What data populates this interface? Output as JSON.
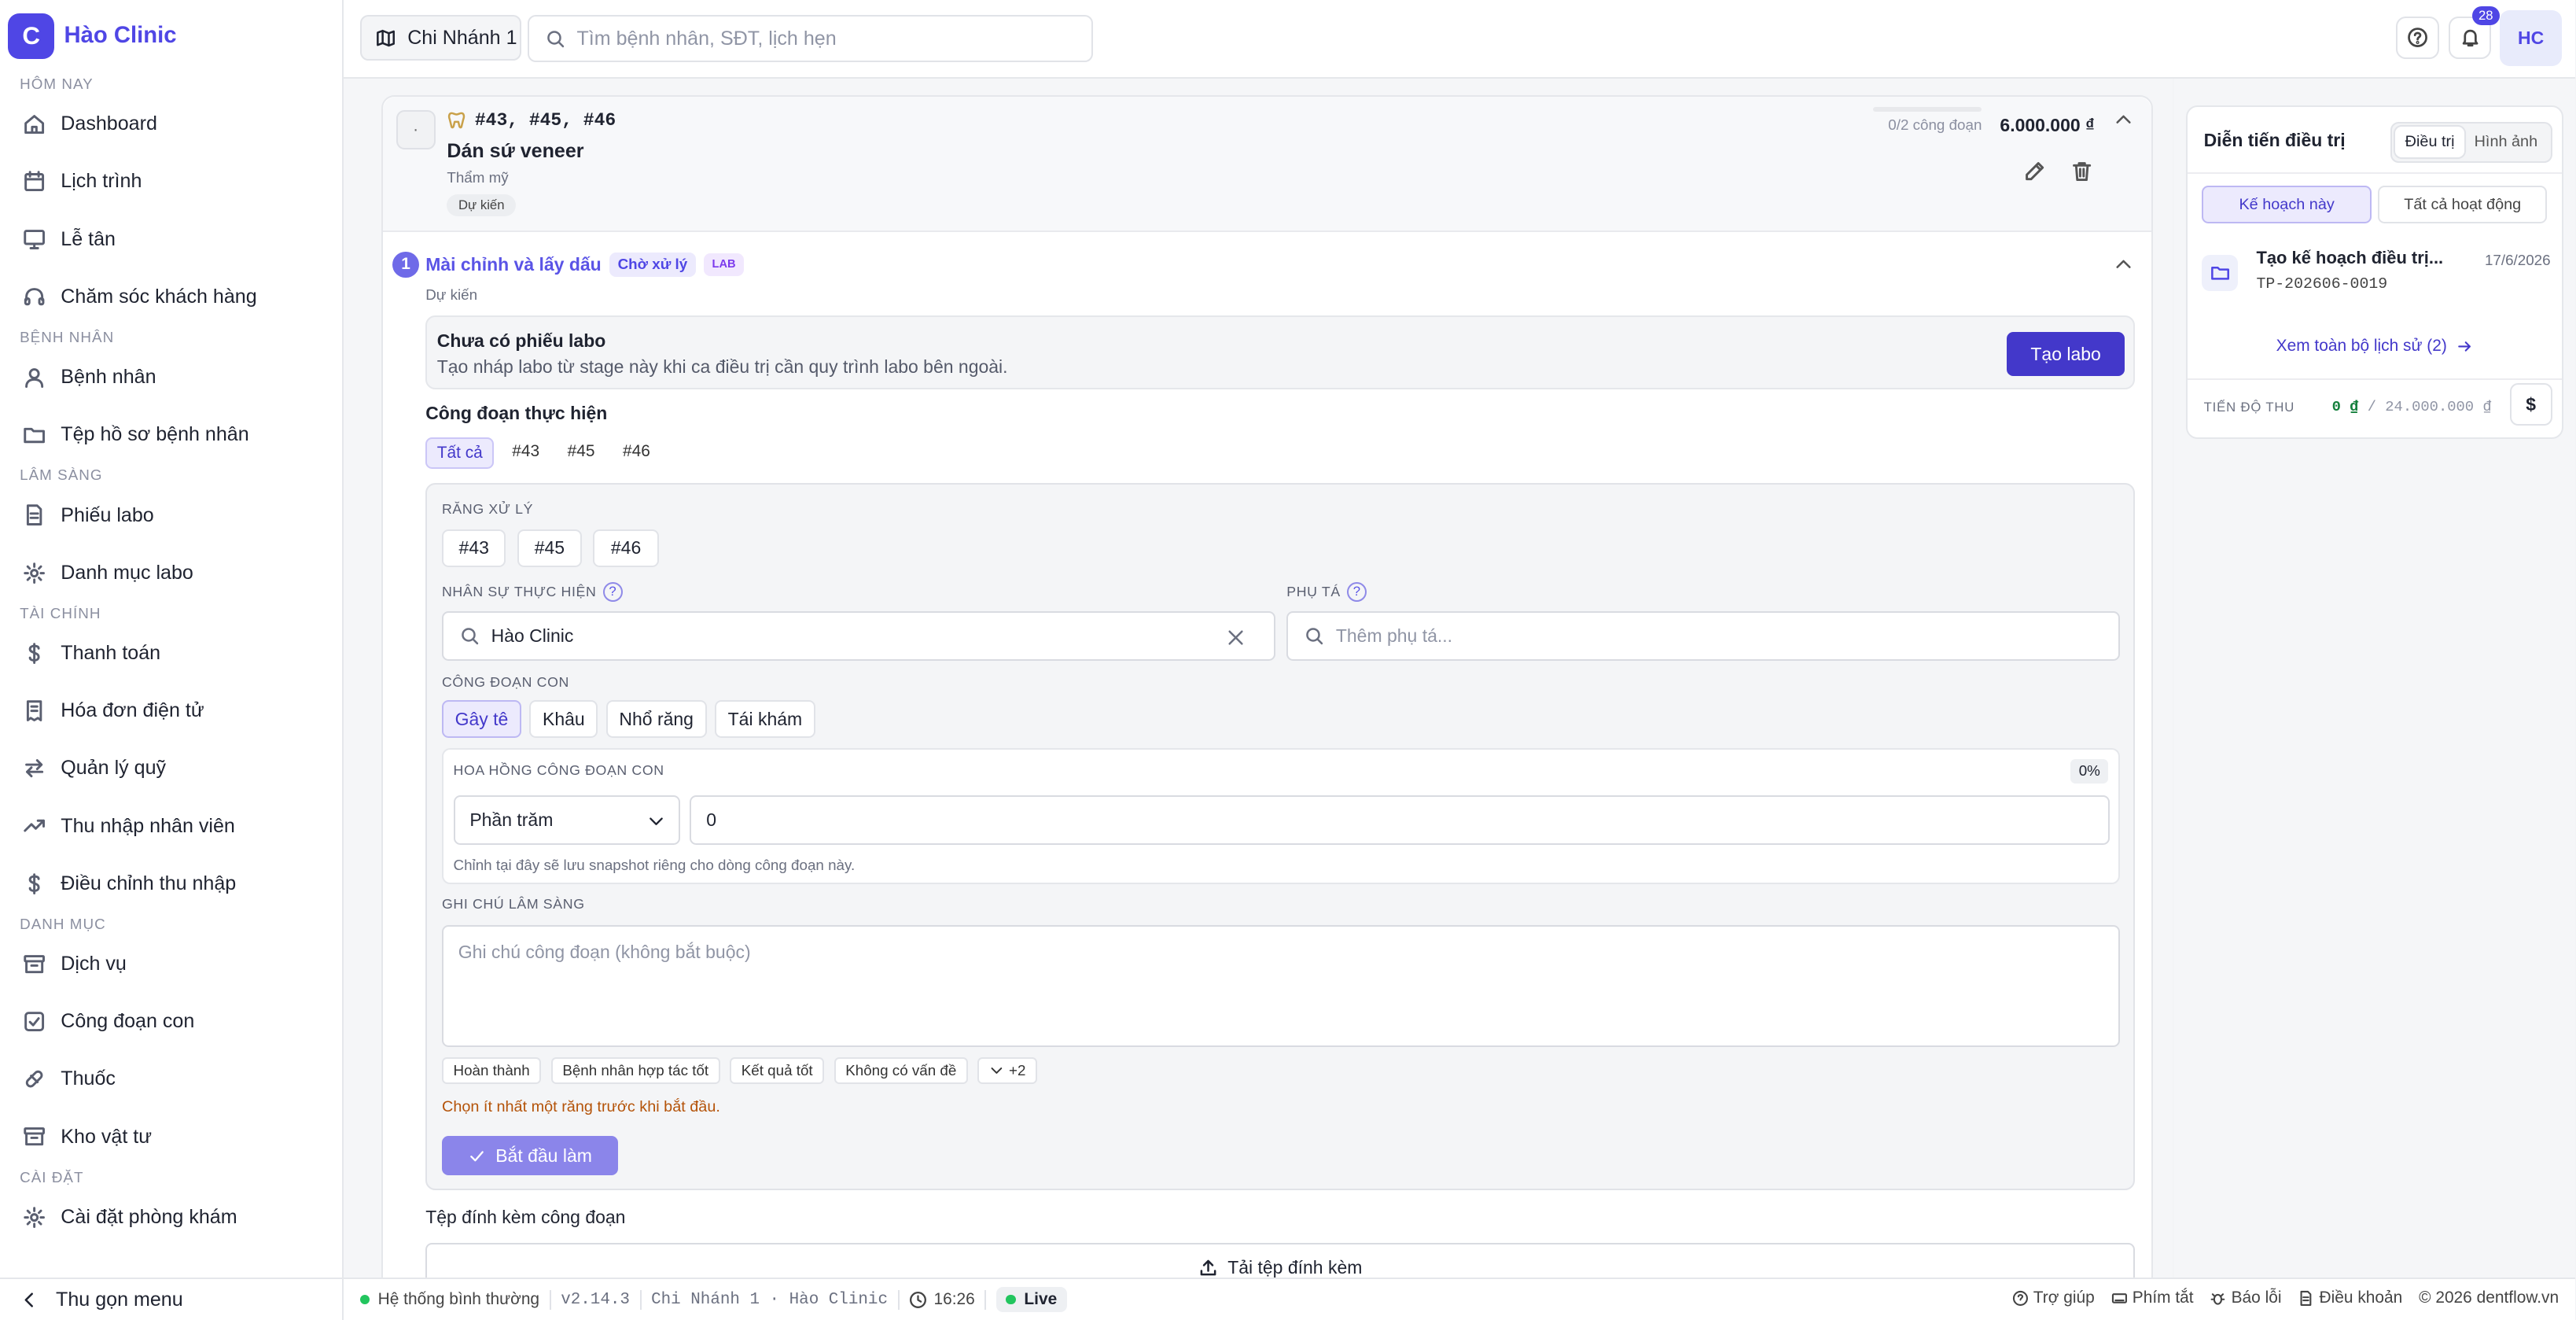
{
  "brand": {
    "logo_letter": "C",
    "name": "Hào Clinic"
  },
  "nav": {
    "groups": [
      {
        "label": "HÔM NAY",
        "items": [
          {
            "label": "Dashboard",
            "icon": "home-icon"
          },
          {
            "label": "Lịch trình",
            "icon": "calendar-icon"
          },
          {
            "label": "Lễ tân",
            "icon": "monitor-icon"
          },
          {
            "label": "Chăm sóc khách hàng",
            "icon": "headset-icon"
          }
        ]
      },
      {
        "label": "BỆNH NHÂN",
        "items": [
          {
            "label": "Bệnh nhân",
            "icon": "user-icon"
          },
          {
            "label": "Tệp hồ sơ bệnh nhân",
            "icon": "folder-icon"
          }
        ]
      },
      {
        "label": "LÂM SÀNG",
        "items": [
          {
            "label": "Phiếu labo",
            "icon": "file-icon"
          },
          {
            "label": "Danh mục labo",
            "icon": "gear-icon"
          }
        ]
      },
      {
        "label": "TÀI CHÍNH",
        "items": [
          {
            "label": "Thanh toán",
            "icon": "dollar-icon"
          },
          {
            "label": "Hóa đơn điện tử",
            "icon": "receipt-icon"
          },
          {
            "label": "Quản lý quỹ",
            "icon": "transfer-icon"
          },
          {
            "label": "Thu nhập nhân viên",
            "icon": "trend-icon"
          },
          {
            "label": "Điều chỉnh thu nhập",
            "icon": "dollar-icon"
          }
        ]
      },
      {
        "label": "DANH MỤC",
        "items": [
          {
            "label": "Dịch vụ",
            "icon": "archive-icon"
          },
          {
            "label": "Công đoạn con",
            "icon": "check-square-icon"
          },
          {
            "label": "Thuốc",
            "icon": "pill-icon"
          },
          {
            "label": "Kho vật tư",
            "icon": "archive-icon"
          }
        ]
      },
      {
        "label": "CÀI ĐẶT",
        "items": [
          {
            "label": "Cài đặt phòng khám",
            "icon": "gear-icon"
          }
        ]
      }
    ],
    "collapse_label": "Thu gọn menu"
  },
  "topbar": {
    "branch": "Chi Nhánh 1",
    "search_placeholder": "Tìm bệnh nhân, SĐT, lịch hẹn",
    "notif_count": "28",
    "avatar": "HC"
  },
  "plan_item": {
    "dot": "·",
    "teeth": "#43, #45, #46",
    "title": "Dán sứ veneer",
    "category": "Thẩm mỹ",
    "status": "Dự kiến",
    "progress_text": "0/2 công đoạn",
    "progress_fraction": 0,
    "price": "6.000.000 ₫"
  },
  "stage": {
    "number": "1",
    "name": "Mài chỉnh và lấy dấu",
    "badge_status": "Chờ xử lý",
    "badge_lab": "LAB",
    "status": "Dự kiến",
    "lab": {
      "title": "Chưa có phiếu labo",
      "desc": "Tạo nháp labo từ stage này khi ca điều trị cần quy trình labo bên ngoài.",
      "button": "Tạo labo"
    },
    "section_title": "Công đoạn thực hiện",
    "filters": [
      "Tất cả",
      "#43",
      "#45",
      "#46"
    ],
    "form": {
      "teeth_label": "RĂNG XỬ LÝ",
      "teeth": [
        "#43",
        "#45",
        "#46"
      ],
      "staff_label": "NHÂN SỰ THỰC HIỆN",
      "staff_value": "Hào Clinic",
      "assistant_label": "PHỤ TÁ",
      "assistant_placeholder": "Thêm phụ tá...",
      "substage_label": "CÔNG ĐOẠN CON",
      "substages": [
        "Gây tê",
        "Khâu",
        "Nhổ răng",
        "Tái khám"
      ],
      "commission_label": "HOA HỒNG CÔNG ĐOẠN CON",
      "commission_pct": "0%",
      "commission_type": "Phần trăm",
      "commission_value": "0",
      "commission_help": "Chỉnh tại đây sẽ lưu snapshot riêng cho dòng công đoạn này.",
      "note_label": "GHI CHÚ LÂM SÀNG",
      "note_placeholder": "Ghi chú công đoạn (không bắt buộc)",
      "quick_notes": [
        "Hoàn thành",
        "Bệnh nhân hợp tác tốt",
        "Kết quả tốt",
        "Không có vấn đề"
      ],
      "more_notes": "+2",
      "warning": "Chọn ít nhất một răng trước khi bắt đầu.",
      "start_button": "Bắt đầu làm"
    },
    "attach_title": "Tệp đính kèm công đoạn",
    "upload_button": "Tải tệp đính kèm"
  },
  "right": {
    "title": "Diễn tiến điều trị",
    "seg": [
      "Điều trị",
      "Hình ảnh"
    ],
    "scope_tabs": [
      "Kế hoạch này",
      "Tất cả hoạt động"
    ],
    "plan_name": "Tạo kế hoạch điều trị...",
    "plan_code": "TP-202606-0019",
    "plan_date": "17/6/2026",
    "history_link": "Xem toàn bộ lịch sử (2)",
    "pay_label": "TIẾN ĐỘ THU",
    "paid": "0 ₫",
    "total": "/ 24.000.000 ₫",
    "pay_button": "$"
  },
  "footer": {
    "status": "Hệ thống bình thường",
    "version": "v2.14.3",
    "branch": "Chi Nhánh 1 · Hào Clinic",
    "time": "16:26",
    "live": "Live",
    "links": [
      "Trợ giúp",
      "Phím tắt",
      "Báo lỗi",
      "Điều khoản"
    ],
    "copyright": "© 2026 dentflow.vn"
  }
}
